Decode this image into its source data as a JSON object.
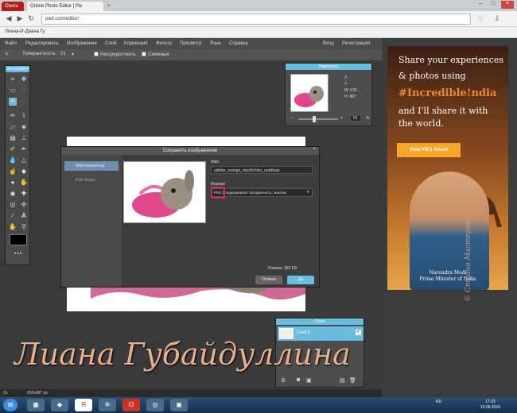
{
  "browser": {
    "opera_tab": "Opera",
    "active_tab": "Online Photo Editor | Pix",
    "address": "pixlr.com/editor/",
    "bookmark": "Лиана-И-Диана Гу"
  },
  "menu": [
    "Файл",
    "Редактировать",
    "Изображение",
    "Слой",
    "Коррекция",
    "Фильтр",
    "Просмотр",
    "Язык",
    "Справка"
  ],
  "account": {
    "login": "Вход",
    "register": "Регистрация"
  },
  "options": {
    "tolerance_label": "Толерантность:",
    "tolerance_value": "21",
    "contiguous_label": "Рассредоточить",
    "antialias_label": "Смежные"
  },
  "tools_header": "Инструмент",
  "navigator": {
    "title": "Навигатор",
    "x_label": "X:",
    "y_label": "Y:",
    "w_label": "W:",
    "w_value": "630",
    "h_label": "H:",
    "h_value": "487",
    "zoom": "91",
    "zoom_unit": "%"
  },
  "dialog": {
    "title": "Сохранить изображение",
    "side_pc": "Мой компьютер",
    "side_lib": "Pixlr library",
    "name_label": "Имя:",
    "name_value": "udivite_svoego_muzhchinu_readmas",
    "format_label": "Формат:",
    "format_value": "PNG (Поддерживает прозрачность, максим",
    "size": "Размер: 352 KB",
    "cancel": "Отмена",
    "ok": "Да"
  },
  "layers": {
    "title": "Слои",
    "layer": "Слой 0"
  },
  "status": {
    "zoom": "91",
    "size": "650x487 px"
  },
  "ad": {
    "line1": "Share your experiences",
    "line2": "& photos using",
    "brand": "#Incredible!ndia",
    "line3": "and I'll share it with",
    "line4": "the world.",
    "button": "View PM's Album",
    "name": "Narendra Modi",
    "role": "Prime Minister of India"
  },
  "watermark": {
    "signature": "Лиана Губайдуллина",
    "side": "© Страна Мастеров"
  },
  "taskbar": {
    "lang": "RU",
    "time": "17:23",
    "date": "15.06.2015"
  },
  "colors": {
    "accent": "#69bde0",
    "highlight": "#d6246e",
    "ad_button": "#f7a62a"
  }
}
